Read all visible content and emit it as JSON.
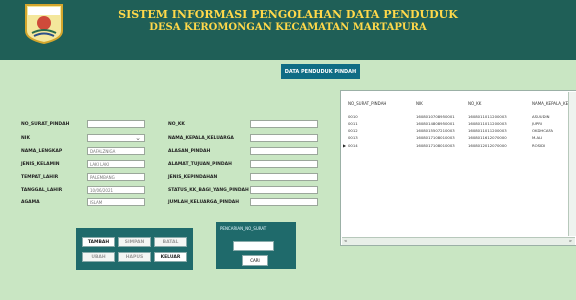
{
  "header": {
    "title_line1": "SISTEM INFORMASI PENGOLAHAN DATA PENDUDUK",
    "title_line2": "DESA KEROMONGAN KECAMATAN MARTAPURA"
  },
  "main": {
    "button_label": "DATA PENDUDUK PINDAH"
  },
  "form": {
    "labels": {
      "no_surat_pindah": "NO_SURAT_PINDAH",
      "nik": "NIK",
      "nama_lengkap": "NAMA_LENGKAP",
      "jenis_kelamin": "JENIS_KELAMIN",
      "tempat_lahir": "TEMPAT_LAHIR",
      "tanggal_lahir": "TANGGAL_LAHIR",
      "agama": "AGAMA",
      "no_kk": "NO_KK",
      "nama_kepala_keluarga": "NAMA_KEPALA_KELUARGA",
      "alasan_pindah": "ALASAN_PINDAH",
      "alamat_tujuan_pindah": "ALAMAT_TUJUAN_PINDAH",
      "jenis_kepindahan": "JENIS_KEPINDAHAN",
      "status_kk_bagi_yang_pindah": "STATUS_KK_BAGI_YANG_PINDAH",
      "jumlah_keluarga_pindah": "JUMLAH_KELUARGA_PINDAH"
    },
    "values": {
      "no_surat_pindah": "",
      "nik": "",
      "nama_lengkap": "DAFALZNIGA",
      "jenis_kelamin": "LAKI LAKI",
      "tempat_lahir": "PALEMBANG",
      "tanggal_lahir": "10/06/2021",
      "agama": "ISLAM",
      "no_kk": "",
      "nama_kepala_keluarga": "",
      "alasan_pindah": "",
      "alamat_tujuan_pindah": "",
      "jenis_kepindahan": "",
      "status_kk_bagi_yang_pindah": "",
      "jumlah_keluarga_pindah": ""
    }
  },
  "table": {
    "headers": [
      "NO_SURAT_PINDAH",
      "NIK",
      "NO_KK",
      "NAMA_KEPALA_KE"
    ],
    "rows": [
      [
        "0010",
        "1608010708950001",
        "1608011011200003",
        "ASUUDIN"
      ],
      [
        "0011",
        "1608014808950001",
        "1608011011200003",
        "JUPRI"
      ],
      [
        "0012",
        "1608015507210003",
        "1608011011200003",
        "OKDHCAFA"
      ],
      [
        "0013",
        "1608017108010003",
        "1608011612070000",
        "M.ALI"
      ],
      [
        "0014",
        "1608017108010003",
        "1608012012070000",
        "ROSIDI"
      ]
    ],
    "selected_row_marker": "▶",
    "hscroll_left": "<",
    "hscroll_right": ">"
  },
  "buttons": {
    "tambah": "TAMBAH",
    "simpan": "SIMPAN",
    "batal": "BATAL",
    "ubah": "UBAH",
    "hapus": "HAPUS",
    "keluar": "KELUAR"
  },
  "search": {
    "label": "PENCARIAN_NO_SURAT",
    "input_value": "",
    "button_label": "CARI"
  }
}
